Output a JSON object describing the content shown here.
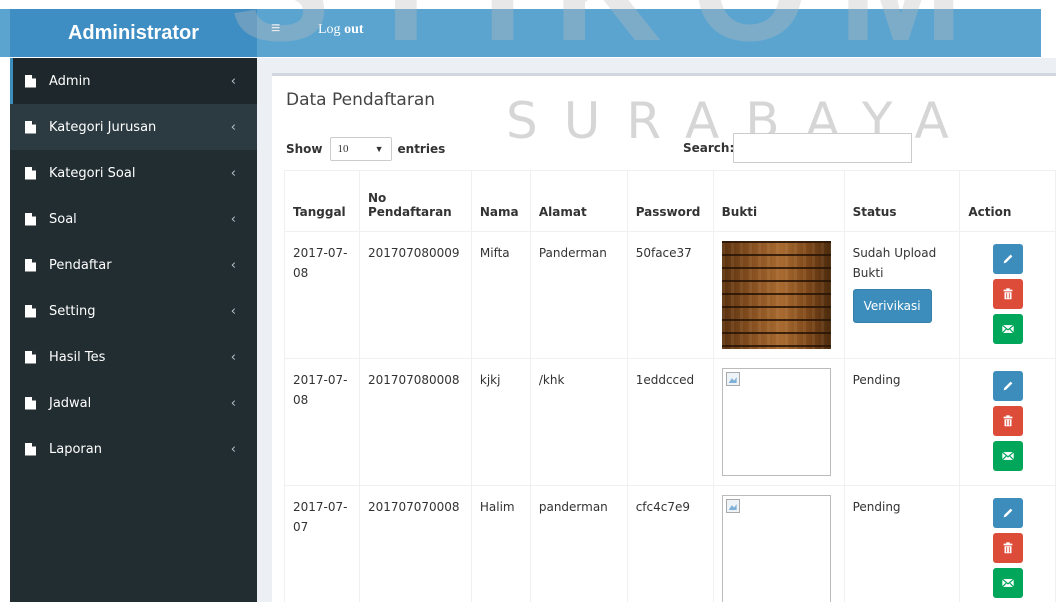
{
  "header": {
    "brand": "Administrator",
    "menu_toggle": "≡",
    "logout_prefix": "Log ",
    "logout_bold": "out"
  },
  "watermark": {
    "top": "STIKOM",
    "sub": "SURABAYA"
  },
  "sidebar": {
    "items": [
      {
        "label": "Admin"
      },
      {
        "label": "Kategori Jurusan"
      },
      {
        "label": "Kategori Soal"
      },
      {
        "label": "Soal"
      },
      {
        "label": "Pendaftar"
      },
      {
        "label": "Setting"
      },
      {
        "label": "Hasil Tes"
      },
      {
        "label": "Jadwal"
      },
      {
        "label": "Laporan"
      }
    ],
    "chevron": "‹"
  },
  "main": {
    "title": "Data Pendaftaran",
    "show_label": "Show",
    "entries_value": "10",
    "entries_label": "entries",
    "search_label": "Search:",
    "columns": [
      "Tanggal",
      "No Pendaftaran",
      "Nama",
      "Alamat",
      "Password",
      "Bukti",
      "Status",
      "Action"
    ],
    "rows": [
      {
        "tanggal": "2017-07-08",
        "no": "201707080009",
        "nama": "Mifta",
        "alamat": "Panderman",
        "password": "50face37",
        "status": "Sudah Upload Bukti",
        "verify": "Verivikasi"
      },
      {
        "tanggal": "2017-07-08",
        "no": "201707080008",
        "nama": "kjkj",
        "alamat": "/khk",
        "password": "1eddcced",
        "status": "Pending"
      },
      {
        "tanggal": "2017-07-07",
        "no": "201707070008",
        "nama": "Halim",
        "alamat": "panderman",
        "password": "cfc4c7e9",
        "status": "Pending"
      }
    ]
  },
  "colors": {
    "header": "#5ba4d0",
    "brand": "#3f8ec3",
    "sidebar": "#222d32",
    "edit": "#3c8dbc",
    "delete": "#dd4b39",
    "mail": "#00a65a"
  },
  "icons": {
    "toggle": "hamburger-icon",
    "sidebar": "file-icon",
    "edit": "pencil-icon",
    "delete": "trash-icon",
    "mail": "envelope-icon"
  }
}
